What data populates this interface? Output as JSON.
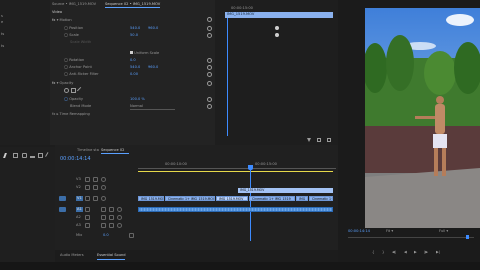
{
  "left_panel": {
    "items": [
      "s",
      "e",
      "ts",
      "ts"
    ]
  },
  "effect_controls": {
    "source_label": "Source • IMG_1519.MOV",
    "tab_active": "Sequence 02 • IMG_1519.MOV",
    "group_video": "Video",
    "group_motion": "Motion",
    "properties": [
      {
        "name": "Position",
        "v1": "540.0",
        "v2": "960.0"
      },
      {
        "name": "Scale",
        "v1": "50.0",
        "v2": ""
      },
      {
        "name": "Scale Width",
        "v1": "",
        "v2": ""
      },
      {
        "name": "Uniform Scale",
        "v1": "",
        "v2": ""
      },
      {
        "name": "Rotation",
        "v1": "0.0",
        "v2": ""
      },
      {
        "name": "Anchor Point",
        "v1": "540.0",
        "v2": "960.0"
      },
      {
        "name": "Anti-flicker Filter",
        "v1": "0.00",
        "v2": ""
      }
    ],
    "group_opacity": "Opacity",
    "opacity_value": "100.0 %",
    "blend_mode_label": "Blend Mode",
    "blend_mode_value": "Normal",
    "time_remapping": "Time Remapping"
  },
  "mini_timeline": {
    "time": "00:00:15:00",
    "clip_label": "IMG_1519.MOV"
  },
  "timeline": {
    "tab_inactive": "Timeline sta",
    "tab_active": "Sequence 02",
    "timecode": "00:00:14:14",
    "ruler_labels": [
      "00:00:10:00",
      "00:00:15:00",
      "00:00:20:00"
    ],
    "tracks": [
      "V3",
      "V2",
      "V1",
      "A1",
      "A2",
      "A3",
      "Mix"
    ],
    "mix_value": "0.0",
    "clip_top_label": "IMG_1519.MOV",
    "video_clips": [
      "IMG_1519.MOV",
      "Cinematic 1+ IMG_1519.MOV",
      "IMG_1519.MOV",
      "Cinematic 1+ IMG_1519",
      "IMG",
      "Cinematic 1+"
    ]
  },
  "bottom_tabs": [
    "Audio Meters",
    "Essential Sound"
  ],
  "program_monitor": {
    "timecode": "00:00:14:14",
    "fit_label": "Fit",
    "full_label": "Full"
  },
  "colors": {
    "accent": "#5aa0ff",
    "playhead": "#3d8bff",
    "work_area": "#e6d84a",
    "video_clip": "#8ab1ee",
    "audio_clip": "#4f8ed8"
  }
}
